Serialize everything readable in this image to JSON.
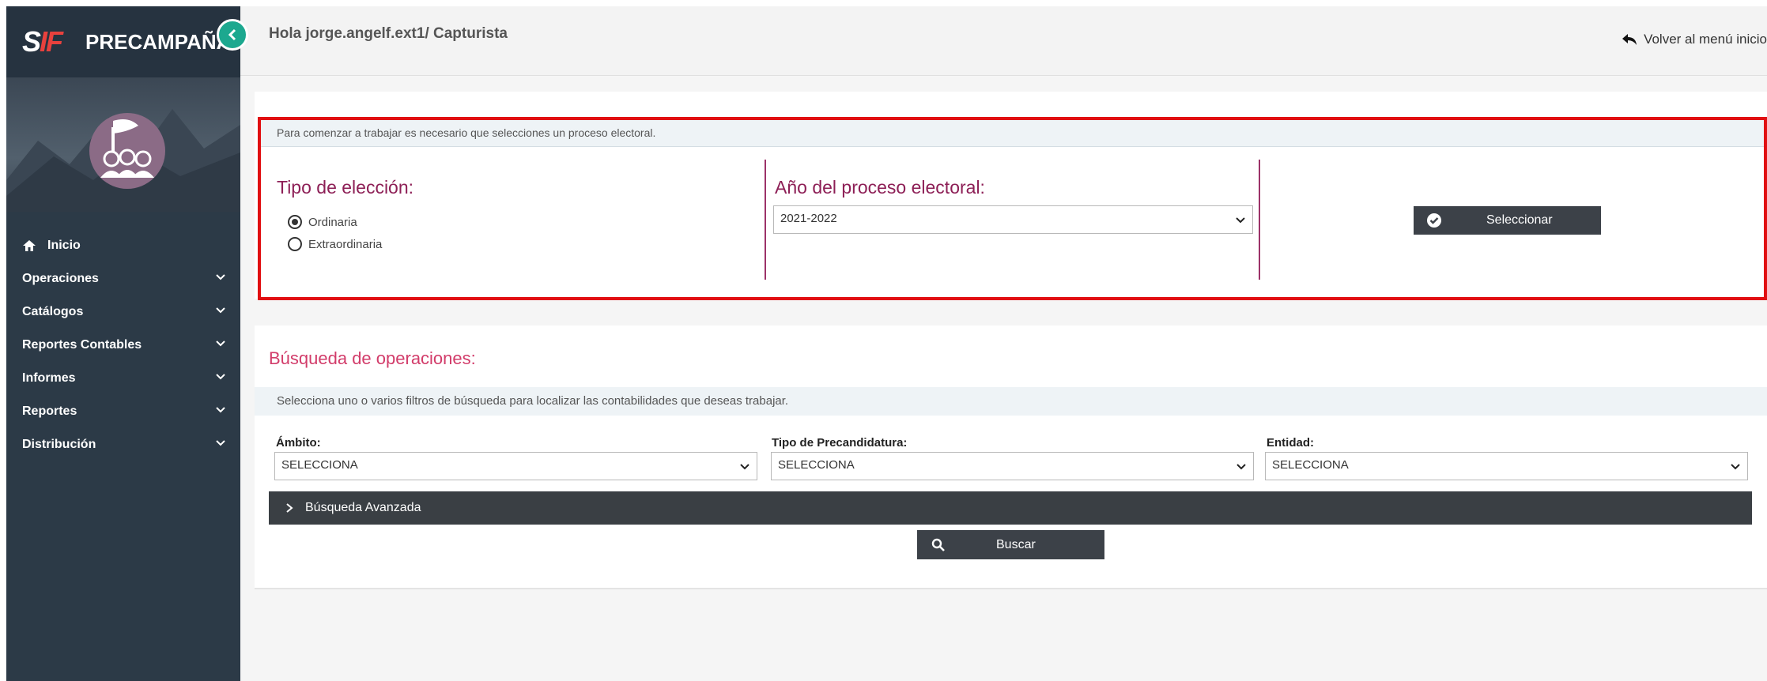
{
  "app": {
    "logo_s": "S",
    "logo_if": "IF",
    "title": "PRECAMPAÑA",
    "collapse_icon": "chevron-left-icon"
  },
  "header": {
    "greeting": "Hola jorge.angelf.ext1/ Capturista",
    "back_label": "Volver al menú inicio"
  },
  "sidebar": {
    "items": [
      {
        "label": "Inicio",
        "icon": "home-icon",
        "expandable": false
      },
      {
        "label": "Operaciones",
        "expandable": true
      },
      {
        "label": "Catálogos",
        "expandable": true
      },
      {
        "label": "Reportes Contables",
        "expandable": true
      },
      {
        "label": "Informes",
        "expandable": true
      },
      {
        "label": "Reportes",
        "expandable": true
      },
      {
        "label": "Distribución",
        "expandable": true
      }
    ]
  },
  "process": {
    "info": "Para comenzar a trabajar es necesario que selecciones un proceso electoral.",
    "tipo_label": "Tipo de elección:",
    "options": [
      {
        "label": "Ordinaria",
        "selected": true
      },
      {
        "label": "Extraordinaria",
        "selected": false
      }
    ],
    "anio_label": "Año del proceso electoral:",
    "anio_value": "2021-2022",
    "select_button": "Seleccionar"
  },
  "search": {
    "title": "Búsqueda de operaciones:",
    "info": "Selecciona uno o varios filtros de búsqueda para localizar las contabilidades que deseas trabajar.",
    "filters": [
      {
        "label": "Ámbito:",
        "value": "SELECCIONA"
      },
      {
        "label": "Tipo de Precandidatura:",
        "value": "SELECCIONA"
      },
      {
        "label": "Entidad:",
        "value": "SELECCIONA"
      }
    ],
    "advanced_label": "Búsqueda Avanzada",
    "search_button": "Buscar"
  },
  "colors": {
    "sidebar": "#2c3a47",
    "accent_teal": "#1ca88f",
    "section_heading": "#8d1f56",
    "highlight_frame": "#e10f12",
    "search_title": "#d23c6a"
  }
}
